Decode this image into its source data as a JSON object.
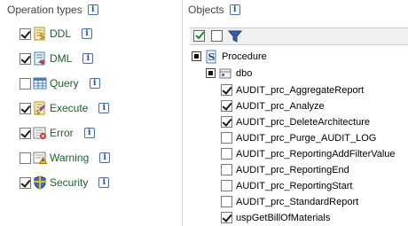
{
  "operation_types": {
    "title": "Operation types",
    "items": [
      {
        "label": "DDL",
        "checked": true,
        "icon": "ddl-icon"
      },
      {
        "label": "DML",
        "checked": true,
        "icon": "dml-icon"
      },
      {
        "label": "Query",
        "checked": false,
        "icon": "query-table-icon"
      },
      {
        "label": "Execute",
        "checked": true,
        "icon": "execute-icon"
      },
      {
        "label": "Error",
        "checked": true,
        "icon": "error-icon"
      },
      {
        "label": "Warning",
        "checked": false,
        "icon": "warning-icon"
      },
      {
        "label": "Security",
        "checked": true,
        "icon": "security-shield-icon"
      }
    ]
  },
  "objects": {
    "title": "Objects",
    "toolbar": [
      "select-all-icon",
      "deselect-all-icon",
      "filter-icon"
    ],
    "procedure_label": "Procedure",
    "schema_label": "dbo",
    "items": [
      {
        "label": "AUDIT_prc_AggregateReport",
        "checked": true
      },
      {
        "label": "AUDIT_prc_Analyze",
        "checked": true
      },
      {
        "label": "AUDIT_prc_DeleteArchitecture",
        "checked": true
      },
      {
        "label": "AUDIT_prc_Purge_AUDIT_LOG",
        "checked": false
      },
      {
        "label": "AUDIT_prc_ReportingAddFilterValue",
        "checked": false
      },
      {
        "label": "AUDIT_prc_ReportingEnd",
        "checked": false
      },
      {
        "label": "AUDIT_prc_ReportingStart",
        "checked": false
      },
      {
        "label": "AUDIT_prc_StandardReport",
        "checked": false
      },
      {
        "label": "uspGetBillOfMaterials",
        "checked": true
      }
    ]
  },
  "colors": {
    "label_green": "#1f5f2a",
    "info_blue": "#2a4d85"
  }
}
